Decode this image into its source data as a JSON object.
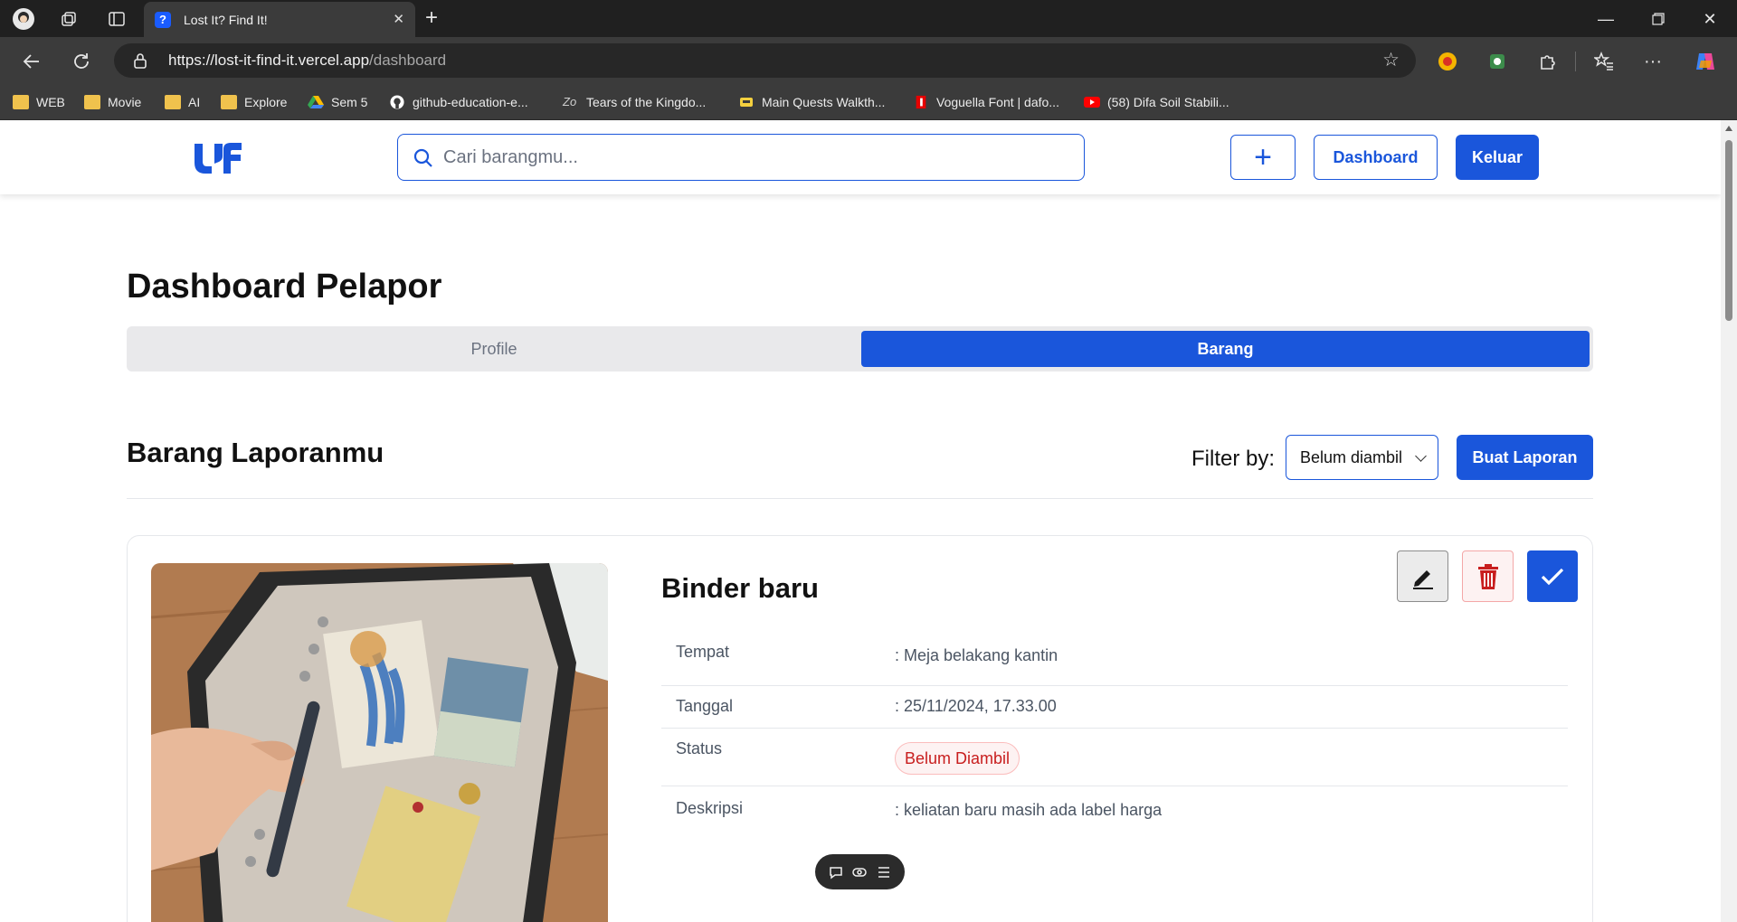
{
  "browser": {
    "tab_title": "Lost It? Find It!",
    "tab_favicon": "?",
    "url_host": "https://lost-it-find-it.vercel.app",
    "url_path": "/dashboard",
    "bookmarks": [
      {
        "label": "WEB",
        "icon": "folder-icon"
      },
      {
        "label": "Movie",
        "icon": "folder-icon"
      },
      {
        "label": "AI",
        "icon": "folder-icon"
      },
      {
        "label": "Explore",
        "icon": "folder-icon"
      },
      {
        "label": "Sem 5",
        "icon": "google-drive-icon"
      },
      {
        "label": "github-education-e...",
        "icon": "github-icon"
      },
      {
        "label": "Tears of the Kingdo...",
        "icon": "zelda-icon"
      },
      {
        "label": "Main Quests Walkth...",
        "icon": "guide-icon"
      },
      {
        "label": "Voguella Font | dafo...",
        "icon": "dafont-icon"
      },
      {
        "label": "(58) Difa Soil Stabili...",
        "icon": "youtube-icon"
      }
    ]
  },
  "navbar": {
    "logo": "LF",
    "search_placeholder": "Cari barangmu...",
    "plus_label": "+",
    "dashboard_label": "Dashboard",
    "logout_label": "Keluar"
  },
  "page": {
    "title": "Dashboard Pelapor",
    "tabs": [
      {
        "label": "Profile",
        "active": false
      },
      {
        "label": "Barang",
        "active": true
      }
    ],
    "section_title": "Barang Laporanmu",
    "filter_label": "Filter by:",
    "filter_value": "Belum diambil",
    "create_report_label": "Buat Laporan"
  },
  "item": {
    "title": "Binder baru",
    "rows": [
      {
        "label": "Tempat",
        "value": ": Meja belakang kantin"
      },
      {
        "label": "Tanggal",
        "value": ": 25/11/2024, 17.33.00"
      },
      {
        "label": "Status",
        "value": "Belum Diambil"
      },
      {
        "label": "Deskripsi",
        "value": ": keliatan baru masih ada label harga"
      }
    ]
  },
  "colors": {
    "primary": "#1a56db",
    "danger": "#c81e1e",
    "chrome_dark": "#202020"
  }
}
